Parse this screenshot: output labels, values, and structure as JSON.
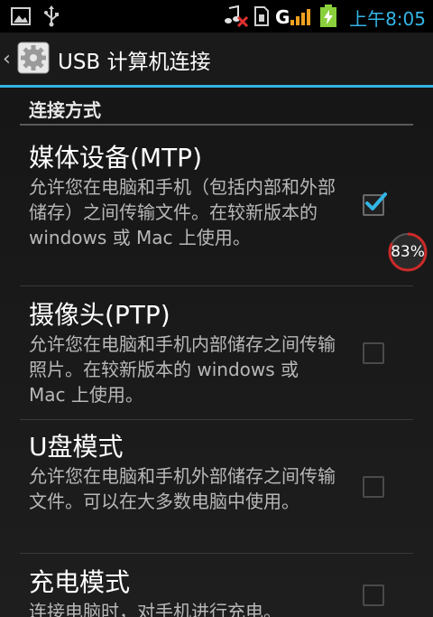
{
  "status_bar": {
    "time": "上午8:05",
    "icons": [
      "image-icon",
      "usb-icon",
      "music-muted-icon",
      "sim-icon",
      "signal-g-icon",
      "battery-charging-icon"
    ]
  },
  "action_bar": {
    "title": "USB 计算机连接",
    "back_icon": "chevron-left-icon",
    "app_icon": "settings-gear-icon"
  },
  "category": {
    "title": "连接方式"
  },
  "options": [
    {
      "title": "媒体设备(MTP)",
      "summary": "允许您在电脑和手机（包括内部和外部储存）之间传输文件。在较新版本的 windows 或 Mac 上使用。",
      "checked": true
    },
    {
      "title": "摄像头(PTP)",
      "summary": "允许您在电脑和手机内部储存之间传输照片。在较新版本的 windows 或 Mac 上使用。",
      "checked": false
    },
    {
      "title": "U盘模式",
      "summary": "允许您在电脑和手机外部储存之间传输文件。可以在大多数电脑中使用。",
      "checked": false
    },
    {
      "title": "充电模式",
      "summary": "连接电脑时，对手机进行充电。",
      "checked": false
    }
  ],
  "overlay_badge": {
    "text": "83%",
    "percent": 83
  },
  "colors": {
    "accent": "#33b5e5",
    "badge_ring": "#cc2a2a"
  }
}
